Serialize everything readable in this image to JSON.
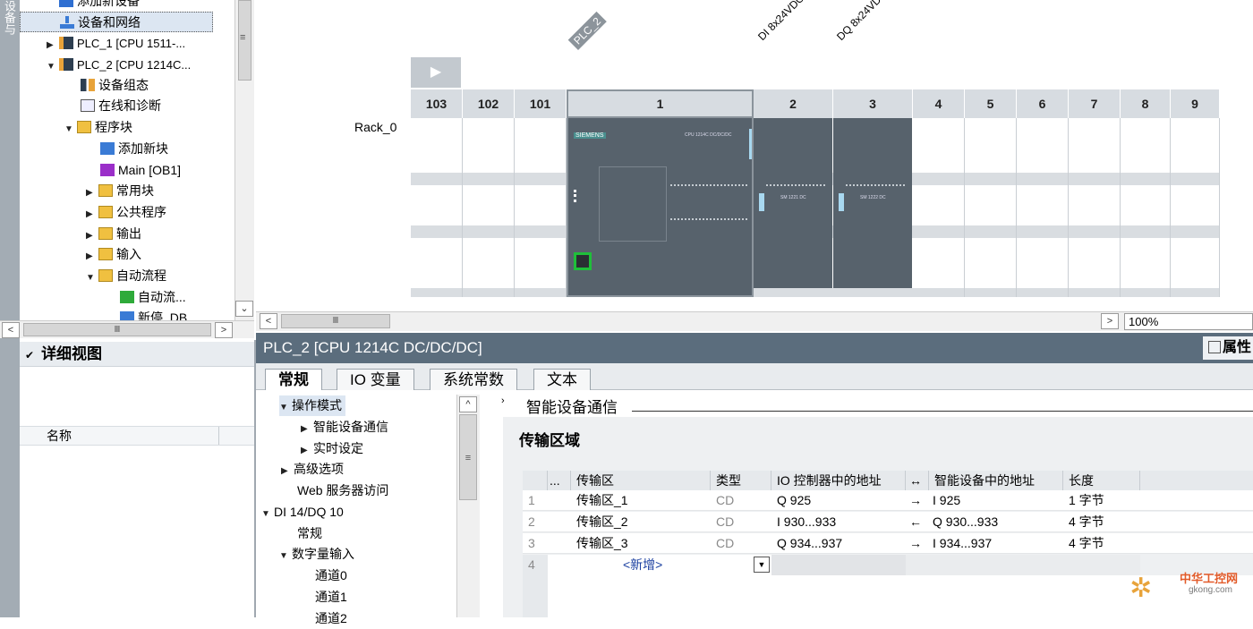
{
  "vertical_strip": {
    "label": "设备与"
  },
  "tree": {
    "items": [
      {
        "label": "添加新设备",
        "level": 0,
        "arrow": ""
      },
      {
        "label": "设备和网络",
        "level": 0,
        "arrow": ""
      },
      {
        "label": "PLC_1 [CPU 1511-...",
        "level": 0,
        "arrow": "▶"
      },
      {
        "label": "PLC_2 [CPU 1214C...",
        "level": 0,
        "arrow": "▼"
      },
      {
        "label": "设备组态",
        "level": 1,
        "arrow": ""
      },
      {
        "label": "在线和诊断",
        "level": 1,
        "arrow": ""
      },
      {
        "label": "程序块",
        "level": 1,
        "arrow": "▼"
      },
      {
        "label": "添加新块",
        "level": 2,
        "arrow": ""
      },
      {
        "label": "Main [OB1]",
        "level": 2,
        "arrow": ""
      },
      {
        "label": "常用块",
        "level": 2,
        "arrow": "▶"
      },
      {
        "label": "公共程序",
        "level": 2,
        "arrow": "▶"
      },
      {
        "label": "输出",
        "level": 2,
        "arrow": "▶"
      },
      {
        "label": "输入",
        "level": 2,
        "arrow": "▶"
      },
      {
        "label": "自动流程",
        "level": 2,
        "arrow": "▼"
      },
      {
        "label": "自动流...",
        "level": 3,
        "arrow": ""
      },
      {
        "label": "新停_DB",
        "level": 3,
        "arrow": ""
      }
    ],
    "scroll_glyph": "Ⅲ"
  },
  "detail_view": {
    "title": "详细视图",
    "column_name": "名称"
  },
  "device_view": {
    "rack_label": "Rack_0",
    "vertical_labels": [
      "PLC_2",
      "DI 8x24VDC",
      "DQ 8x24VDC"
    ],
    "slots": [
      "103",
      "102",
      "101",
      "1",
      "2",
      "3",
      "4",
      "5",
      "6",
      "7",
      "8",
      "9"
    ],
    "module_brand": "SIEMENS",
    "cpu_text": "CPU 1214C DC/DC/DC",
    "sm_text": "SM 1221 DC",
    "sm2_text": "SM 1222 DC",
    "zoom": "100%",
    "scroll_glyph": "Ⅲ"
  },
  "properties": {
    "title": "PLC_2 [CPU 1214C DC/DC/DC]",
    "right_title": "属性",
    "tabs": [
      "常规",
      "IO 变量",
      "系统常数",
      "文本"
    ],
    "nav": [
      {
        "label": "操作模式",
        "level": 1,
        "arrow": "▼"
      },
      {
        "label": "智能设备通信",
        "level": 2,
        "arrow": "▶"
      },
      {
        "label": "实时设定",
        "level": 2,
        "arrow": "▶"
      },
      {
        "label": "高级选项",
        "level": 1,
        "arrow": "▶"
      },
      {
        "label": "Web 服务器访问",
        "level": 1,
        "arrow": ""
      },
      {
        "label": "DI 14/DQ 10",
        "level": 0,
        "arrow": "▼"
      },
      {
        "label": "常规",
        "level": 1,
        "arrow": ""
      },
      {
        "label": "数字量输入",
        "level": 1,
        "arrow": "▼"
      },
      {
        "label": "通道0",
        "level": 2,
        "arrow": ""
      },
      {
        "label": "通道1",
        "level": 2,
        "arrow": ""
      },
      {
        "label": "通道2",
        "level": 2,
        "arrow": ""
      }
    ],
    "section_header": "智能设备通信",
    "section_title": "传输区域",
    "table": {
      "headers": [
        "...",
        "传输区",
        "类型",
        "IO 控制器中的地址",
        "↔",
        "智能设备中的地址",
        "长度"
      ],
      "rows": [
        {
          "num": "1",
          "name": "传输区_1",
          "type": "CD",
          "ctrl": "Q 925",
          "dir": "→",
          "dev": "I 925",
          "len": "1 字节"
        },
        {
          "num": "2",
          "name": "传输区_2",
          "type": "CD",
          "ctrl": "I 930...933",
          "dir": "←",
          "dev": "Q 930...933",
          "len": "4 字节"
        },
        {
          "num": "3",
          "name": "传输区_3",
          "type": "CD",
          "ctrl": "Q 934...937",
          "dir": "→",
          "dev": "I 934...937",
          "len": "4 字节"
        }
      ],
      "new_row": {
        "num": "4",
        "label": "<新增>"
      }
    }
  },
  "watermark": {
    "text": "中华工控网",
    "url": "gkong.com"
  },
  "colors": {
    "title_bar": "#5b6d7d",
    "module": "#57626c",
    "slot_header": "#d7dce1"
  }
}
